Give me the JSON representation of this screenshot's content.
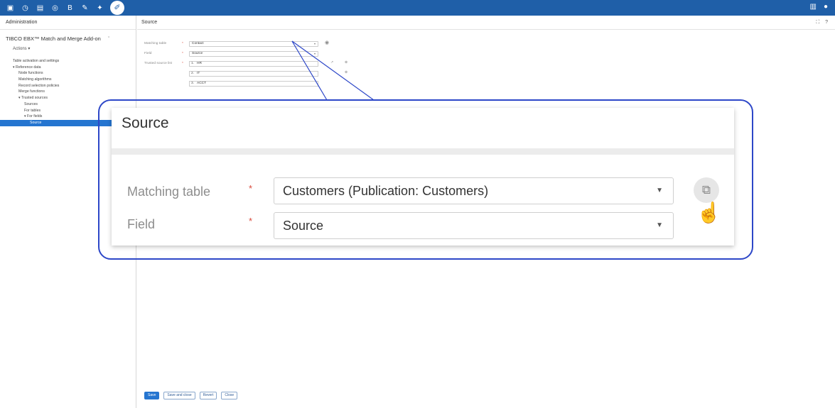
{
  "topbar": {
    "icons": [
      "dataset-icon",
      "clock-icon",
      "document-icon",
      "globe-icon",
      "bold-icon",
      "edit-doc-icon",
      "pin-icon",
      "wrench-icon"
    ],
    "right_icons": [
      "grid-icon",
      "user-icon"
    ]
  },
  "sidebar": {
    "header": "Administration",
    "addon_title": "TIBCO EBX™ Match and Merge Add-on",
    "actions_label": "Actions ▾",
    "items": [
      {
        "label": "Table activation and settings",
        "indent": 0
      },
      {
        "label": "▾ Reference data",
        "indent": 0
      },
      {
        "label": "Node functions",
        "indent": 1
      },
      {
        "label": "Matching algorithms",
        "indent": 1
      },
      {
        "label": "Record selection policies",
        "indent": 1
      },
      {
        "label": "Merge functions",
        "indent": 1
      },
      {
        "label": "▾ Trusted sources",
        "indent": 1
      },
      {
        "label": "Sources",
        "indent": 2
      },
      {
        "label": "For tables",
        "indent": 2
      },
      {
        "label": "▾ For fields",
        "indent": 2
      },
      {
        "label": "Source",
        "indent": 3,
        "selected": true
      }
    ]
  },
  "main": {
    "header": "Source",
    "header_icons": [
      "expand-icon",
      "help-icon"
    ],
    "form": {
      "matching_table_label": "Matching table",
      "matching_table_value": "Contact",
      "field_label": "Field",
      "field_value": "Source",
      "trusted_label": "Trusted source list",
      "trusted_items": [
        {
          "num": "1.",
          "value": "HR"
        },
        {
          "num": "2.",
          "value": "IT"
        },
        {
          "num": "3.",
          "value": "ACCT"
        }
      ],
      "required_mark": "*"
    },
    "buttons": {
      "save": "Save",
      "save_close": "Save and close",
      "revert": "Revert",
      "close": "Close"
    }
  },
  "zoom": {
    "title": "Source",
    "matching_table_label": "Matching table",
    "matching_table_value": "Customers (Publication: Customers)",
    "field_label": "Field",
    "field_value": "Source",
    "required_mark": "*",
    "open_icon": "external-link-icon",
    "cursor_icon": "hand-pointer-icon"
  },
  "colors": {
    "topbar": "#1f5fa8",
    "accent": "#2575d0",
    "callout": "#2d47c8",
    "required": "#d9493b"
  }
}
